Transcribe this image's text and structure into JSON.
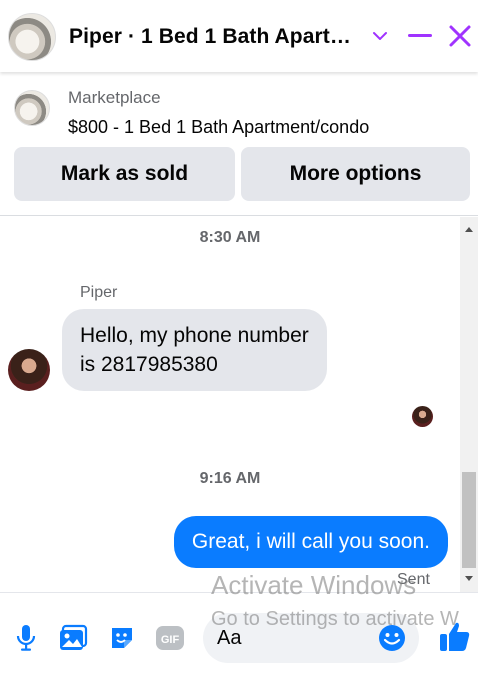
{
  "header": {
    "title": "Piper · 1 Bed 1 Bath Apart…",
    "avatar_icon": "listing-photo",
    "chevron_icon": "chevron-down-icon",
    "minimize_icon": "minimize-icon",
    "close_icon": "close-icon",
    "accent_color": "#a033ff"
  },
  "listing": {
    "source": "Marketplace",
    "name": "$800 - 1 Bed 1 Bath Apartment/condo",
    "mark_sold_label": "Mark as sold",
    "more_options_label": "More options"
  },
  "conversation": {
    "timestamp_1": "8:30 AM",
    "sender_name": "Piper",
    "incoming_message": "Hello, my phone number is 2817985380",
    "timestamp_2": "9:16 AM",
    "outgoing_message": "Great, i will call you soon.",
    "outgoing_status": "Sent",
    "outgoing_color": "#0a7cff"
  },
  "composer": {
    "placeholder": "Aa",
    "icons": [
      "microphone-icon",
      "photo-icon",
      "sticker-icon",
      "gif-icon",
      "emoji-icon",
      "like-icon"
    ],
    "gif_label": "GIF",
    "icon_color": "#0a7cff"
  },
  "watermark": {
    "line1": "Activate Windows",
    "line2": "Go to Settings to activate W"
  }
}
